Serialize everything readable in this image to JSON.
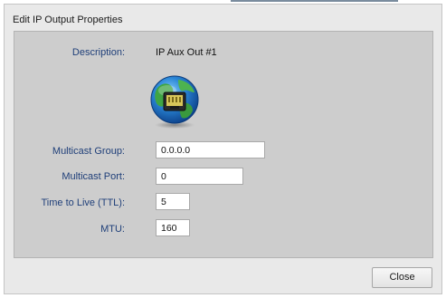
{
  "dialog": {
    "title": "Edit IP Output Properties"
  },
  "form": {
    "description_label": "Description:",
    "description_value": "IP Aux Out #1",
    "multicast_group_label": "Multicast Group:",
    "multicast_group_value": "0.0.0.0",
    "multicast_port_label": "Multicast Port:",
    "multicast_port_value": "0",
    "ttl_label": "Time to Live (TTL):",
    "ttl_value": "5",
    "mtu_label": "MTU:",
    "mtu_value": "160"
  },
  "footer": {
    "close_label": "Close"
  },
  "icons": {
    "device": "network-globe-icon"
  },
  "colors": {
    "label_text": "#1f3f79",
    "panel_bg": "#cdcdcd",
    "dialog_bg": "#e9e9e9"
  }
}
